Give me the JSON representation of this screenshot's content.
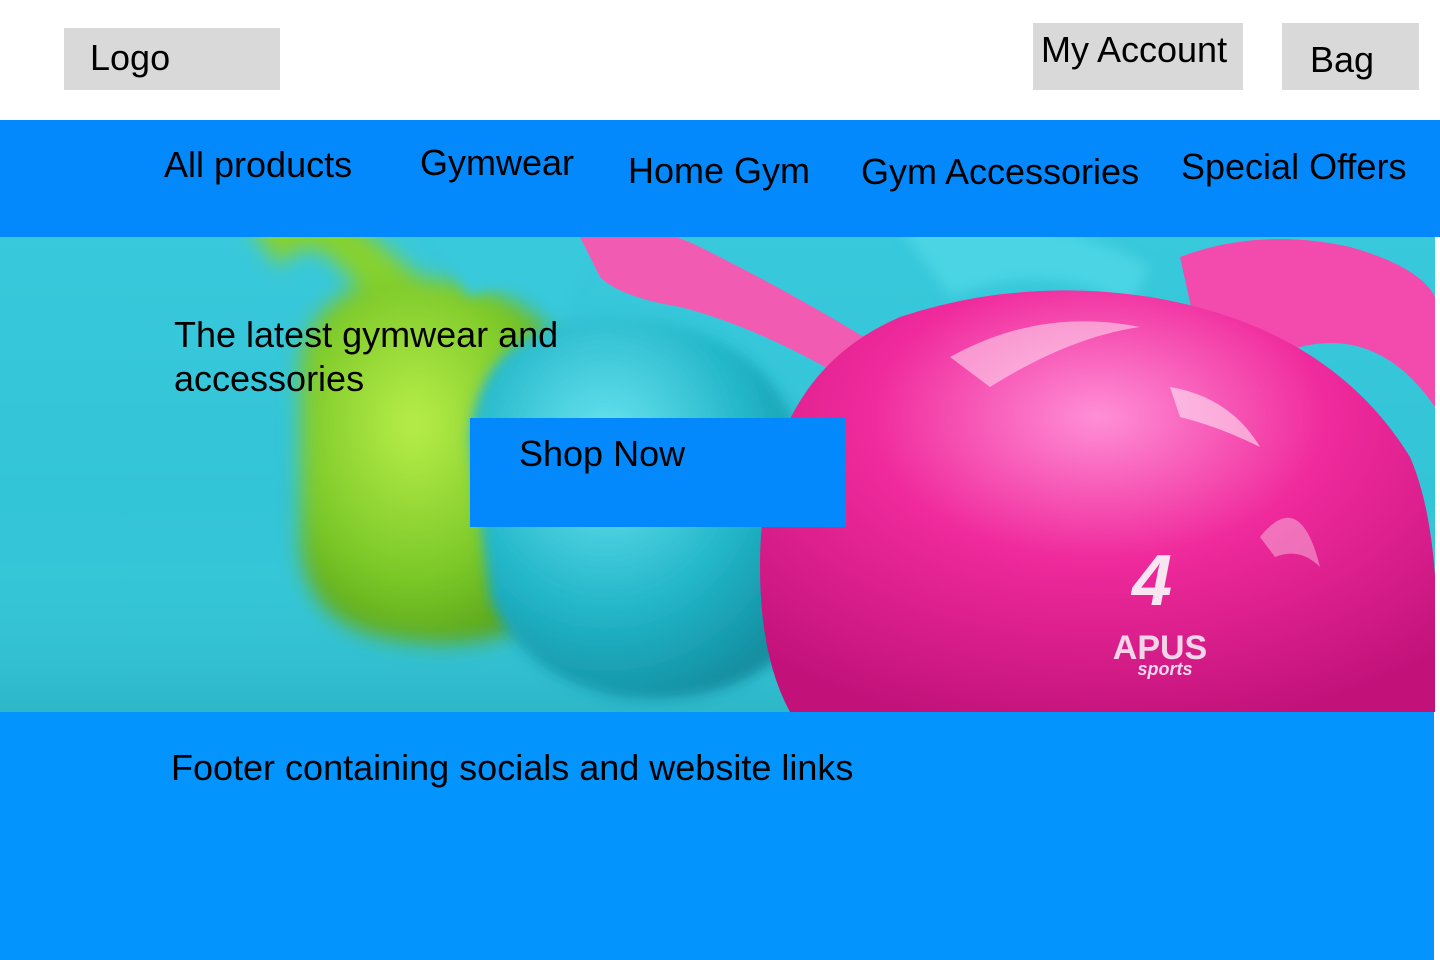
{
  "header": {
    "logo": "Logo",
    "account_label": "My Account",
    "bag_label": "Bag"
  },
  "nav": {
    "items": [
      "All products",
      "Gymwear",
      "Home Gym",
      "Gym Accessories",
      "Special Offers"
    ]
  },
  "hero": {
    "heading": "The latest gymwear and accessories",
    "cta_label": "Shop Now",
    "image": {
      "kettlebell_weight": "4",
      "brand_line1": "APUS",
      "brand_line2": "sports",
      "colors": {
        "background": "#34c4d8",
        "green_bell": "#7bc828",
        "teal_bell": "#22b6c9",
        "pink_bell": "#f02a9c"
      }
    }
  },
  "footer": {
    "text": "Footer containing socials and website links"
  },
  "colors": {
    "nav_bg": "#0389fc",
    "footer_bg": "#0394fd",
    "button_gray": "#d9d9d9",
    "cta_bg": "#0389fc"
  }
}
